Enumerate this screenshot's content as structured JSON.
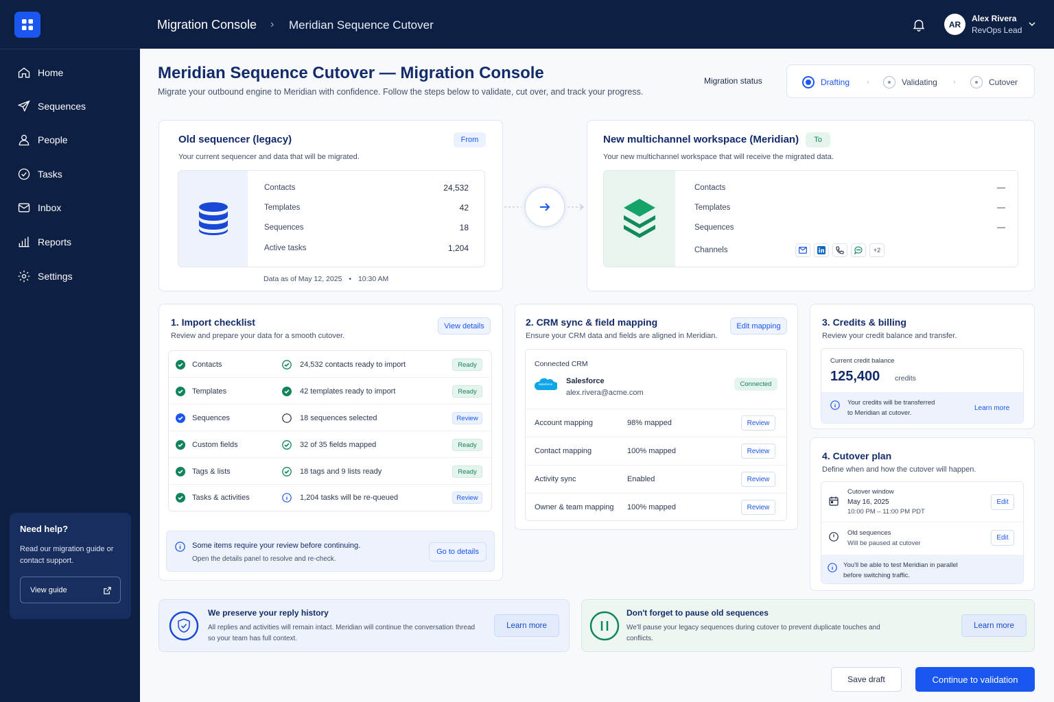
{
  "topbar": {
    "breadcrumb_1": "Migration Console",
    "breadcrumb_2": "Meridian Sequence Cutover",
    "user_initials": "AR",
    "user_name": "Alex Rivera",
    "user_role": "RevOps Lead"
  },
  "sidebar": {
    "items": [
      {
        "label": "Home",
        "icon": "home-icon"
      },
      {
        "label": "Sequences",
        "icon": "send-icon"
      },
      {
        "label": "People",
        "icon": "person-icon"
      },
      {
        "label": "Tasks",
        "icon": "check-circle-icon"
      },
      {
        "label": "Inbox",
        "icon": "mail-icon"
      },
      {
        "label": "Reports",
        "icon": "bar-chart-icon"
      },
      {
        "label": "Settings",
        "icon": "gear-icon"
      }
    ],
    "help": {
      "title": "Need help?",
      "text": "Read our migration guide or contact support.",
      "button": "View guide"
    }
  },
  "header": {
    "title": "Meridian Sequence Cutover — Migration Console",
    "subtitle": "Migrate your outbound engine to Meridian with confidence. Follow the steps below to validate, cut over, and track your progress.",
    "status_label": "Migration status",
    "steps": [
      "Drafting",
      "Validating",
      "Cutover"
    ]
  },
  "source": {
    "title": "Old sequencer (legacy)",
    "badge": "From",
    "subtitle": "Your current sequencer and data that will be migrated.",
    "rows": [
      {
        "label": "Contacts",
        "value": "24,532"
      },
      {
        "label": "Templates",
        "value": "42"
      },
      {
        "label": "Sequences",
        "value": "18"
      },
      {
        "label": "Active tasks",
        "value": "1,204"
      }
    ],
    "as_of": "Data as of May 12, 2025",
    "as_of_dot": "•",
    "as_of_time": "10:30 AM"
  },
  "target": {
    "title": "New multichannel workspace (Meridian)",
    "badge": "To",
    "subtitle": "Your new multichannel workspace that will receive the migrated data.",
    "rows": [
      {
        "label": "Contacts",
        "value": "—"
      },
      {
        "label": "Templates",
        "value": "—"
      },
      {
        "label": "Sequences",
        "value": "—"
      }
    ],
    "channels_label": "Channels",
    "channels_more": "+2"
  },
  "checklist": {
    "title": "1. Import checklist",
    "subtitle": "Review and prepare your data for a smooth cutover.",
    "button": "View details",
    "rows": [
      {
        "item": "Contacts",
        "detail": "24,532 contacts ready to import",
        "status": "Ready",
        "detail_icon": "check"
      },
      {
        "item": "Templates",
        "detail": "42 templates ready to import",
        "status": "Ready",
        "detail_icon": "check"
      },
      {
        "item": "Sequences",
        "detail": "18 sequences selected",
        "status": "Review",
        "detail_icon": "empty"
      },
      {
        "item": "Custom fields",
        "detail": "32 of 35 fields mapped",
        "status": "Ready",
        "detail_icon": "check"
      },
      {
        "item": "Tags & lists",
        "detail": "18 tags and 9 lists ready",
        "status": "Ready",
        "detail_icon": "check"
      },
      {
        "item": "Tasks & activities",
        "detail": "1,204 tasks will be re-queued",
        "status": "Review",
        "detail_icon": "info"
      }
    ],
    "notice_title": "Some items require your review before continuing.",
    "notice_text": "Open the details panel to resolve and re-check.",
    "notice_button": "Go to details"
  },
  "crm": {
    "title": "2. CRM sync & field mapping",
    "subtitle": "Ensure your CRM data and fields are aligned in Meridian.",
    "button": "Edit mapping",
    "connected_label": "Connected CRM",
    "crm_name": "Salesforce",
    "crm_logo_text": "salesforce",
    "crm_email": "alex.rivera@acme.com",
    "crm_status": "Connected",
    "rows": [
      {
        "label": "Account mapping",
        "value": "98% mapped",
        "action": "Review"
      },
      {
        "label": "Contact mapping",
        "value": "100% mapped",
        "action": "Review"
      },
      {
        "label": "Activity sync",
        "value": "Enabled",
        "action": "Review"
      },
      {
        "label": "Owner & team mapping",
        "value": "100% mapped",
        "action": "Review"
      }
    ]
  },
  "credits": {
    "title": "3. Credits & billing",
    "subtitle": "Review your credit balance and transfer.",
    "balance_label": "Current credit balance",
    "balance": "125,400",
    "balance_unit": "credits",
    "note_line1": "Your credits will be transferred",
    "note_line2": "to Meridian at cutover.",
    "link": "Learn more"
  },
  "cutover": {
    "title": "4. Cutover plan",
    "subtitle": "Define when and how the cutover will happen.",
    "window_label": "Cutover window",
    "window_date": "May 16, 2025",
    "window_time": "10:00 PM – 11:00 PM PDT",
    "old_label": "Old sequences",
    "old_text": "Will be paused at cutover",
    "edit": "Edit",
    "note_line1": "You'll be able to test Meridian in parallel",
    "note_line2": "before switching traffic."
  },
  "notices": {
    "history_title": "We preserve your reply history",
    "history_text": "All replies and activities will remain intact. Meridian will continue the conversation thread so your team has full context.",
    "history_button": "Learn more",
    "pause_title": "Don't forget to pause old sequences",
    "pause_text": "We'll pause your legacy sequences during cutover to prevent duplicate touches and conflicts.",
    "pause_button": "Learn more"
  },
  "footer": {
    "save": "Save draft",
    "continue": "Continue to validation"
  },
  "colors": {
    "navy": "#0e1f44",
    "primary": "#1a56f0",
    "green": "#10845a",
    "title": "#132b6b"
  }
}
